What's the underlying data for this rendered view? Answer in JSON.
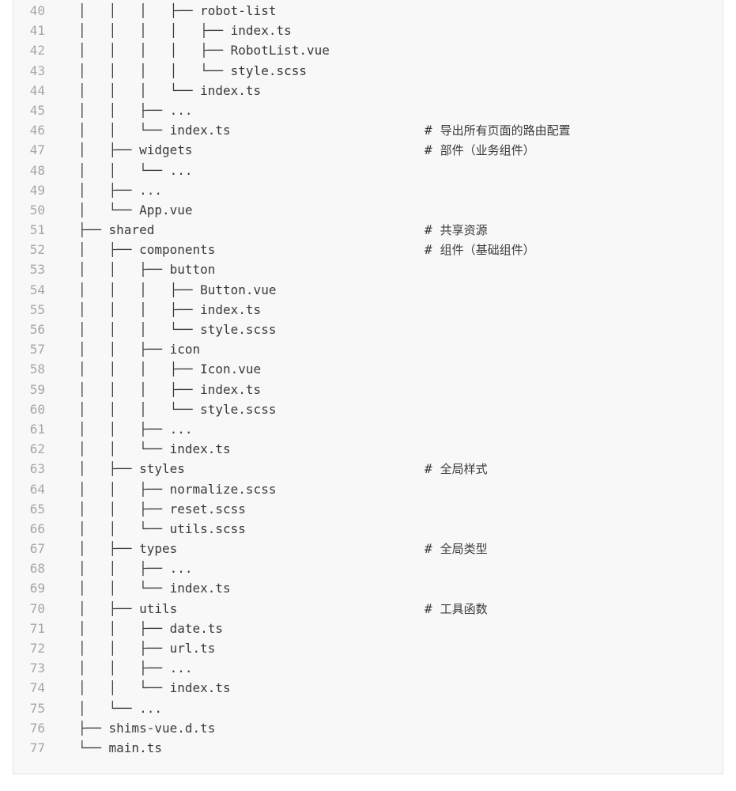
{
  "code_lines": [
    {
      "num": "40",
      "text": "│   │   │   ├── robot-list",
      "comment": ""
    },
    {
      "num": "41",
      "text": "│   │   │   │   ├── index.ts",
      "comment": ""
    },
    {
      "num": "42",
      "text": "│   │   │   │   ├── RobotList.vue",
      "comment": ""
    },
    {
      "num": "43",
      "text": "│   │   │   │   └── style.scss",
      "comment": ""
    },
    {
      "num": "44",
      "text": "│   │   │   └── index.ts",
      "comment": ""
    },
    {
      "num": "45",
      "text": "│   │   ├── ...",
      "comment": ""
    },
    {
      "num": "46",
      "text": "│   │   └── index.ts",
      "comment": "导出所有页面的路由配置"
    },
    {
      "num": "47",
      "text": "│   ├── widgets",
      "comment": "部件（业务组件）"
    },
    {
      "num": "48",
      "text": "│   │   └── ...",
      "comment": ""
    },
    {
      "num": "49",
      "text": "│   ├── ...",
      "comment": ""
    },
    {
      "num": "50",
      "text": "│   └── App.vue",
      "comment": ""
    },
    {
      "num": "51",
      "text": "├── shared",
      "comment": "共享资源"
    },
    {
      "num": "52",
      "text": "│   ├── components",
      "comment": "组件（基础组件）"
    },
    {
      "num": "53",
      "text": "│   │   ├── button",
      "comment": ""
    },
    {
      "num": "54",
      "text": "│   │   │   ├── Button.vue",
      "comment": ""
    },
    {
      "num": "55",
      "text": "│   │   │   ├── index.ts",
      "comment": ""
    },
    {
      "num": "56",
      "text": "│   │   │   └── style.scss",
      "comment": ""
    },
    {
      "num": "57",
      "text": "│   │   ├── icon",
      "comment": ""
    },
    {
      "num": "58",
      "text": "│   │   │   ├── Icon.vue",
      "comment": ""
    },
    {
      "num": "59",
      "text": "│   │   │   ├── index.ts",
      "comment": ""
    },
    {
      "num": "60",
      "text": "│   │   │   └── style.scss",
      "comment": ""
    },
    {
      "num": "61",
      "text": "│   │   ├── ...",
      "comment": ""
    },
    {
      "num": "62",
      "text": "│   │   └── index.ts",
      "comment": ""
    },
    {
      "num": "63",
      "text": "│   ├── styles",
      "comment": "全局样式"
    },
    {
      "num": "64",
      "text": "│   │   ├── normalize.scss",
      "comment": ""
    },
    {
      "num": "65",
      "text": "│   │   ├── reset.scss",
      "comment": ""
    },
    {
      "num": "66",
      "text": "│   │   └── utils.scss",
      "comment": ""
    },
    {
      "num": "67",
      "text": "│   ├── types",
      "comment": "全局类型"
    },
    {
      "num": "68",
      "text": "│   │   ├── ...",
      "comment": ""
    },
    {
      "num": "69",
      "text": "│   │   └── index.ts",
      "comment": ""
    },
    {
      "num": "70",
      "text": "│   ├── utils",
      "comment": "工具函数"
    },
    {
      "num": "71",
      "text": "│   │   ├── date.ts",
      "comment": ""
    },
    {
      "num": "72",
      "text": "│   │   ├── url.ts",
      "comment": ""
    },
    {
      "num": "73",
      "text": "│   │   ├── ...",
      "comment": ""
    },
    {
      "num": "74",
      "text": "│   │   └── index.ts",
      "comment": ""
    },
    {
      "num": "75",
      "text": "│   └── ...",
      "comment": ""
    },
    {
      "num": "76",
      "text": "├── shims-vue.d.ts",
      "comment": ""
    },
    {
      "num": "77",
      "text": "└── main.ts",
      "comment": ""
    }
  ],
  "comment_marker": "#"
}
